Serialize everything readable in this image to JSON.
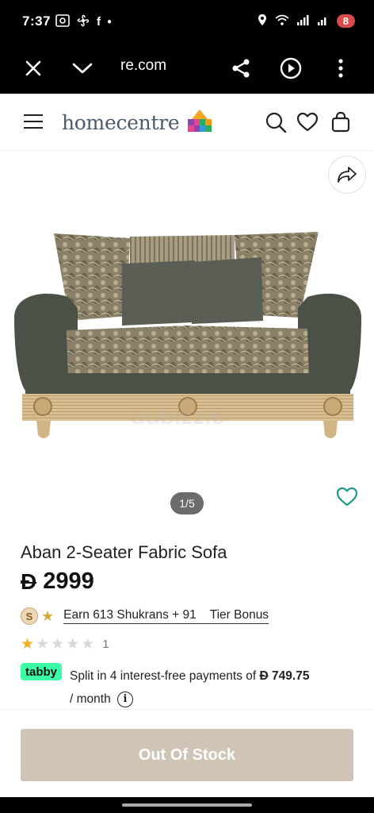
{
  "status_bar": {
    "time": "7:37",
    "battery": "8"
  },
  "browser": {
    "url": "re.com"
  },
  "site": {
    "logo_text": "homecentre"
  },
  "gallery": {
    "pager": "1/5",
    "watermark": "dubizzle"
  },
  "product": {
    "title": "Aban 2-Seater Fabric Sofa",
    "currency_symbol": "Đ",
    "price": "2999",
    "shukran_text": "Earn 613 Shukrans + 91    Tier Bonus",
    "rating_stars": 1,
    "rating_max": 5,
    "rating_count": "1",
    "tabby_label": "tabby",
    "tabby_text_before": "Split in 4 interest-free payments of",
    "tabby_currency": "Đ",
    "tabby_amount": "749.75",
    "tabby_text_after": "/ month"
  },
  "actions": {
    "out_of_stock_label": "Out Of Stock"
  },
  "colors": {
    "tabby_green": "#3bffa6",
    "oos_button": "#cfc4b6",
    "wishlist_teal": "#1f9a8a",
    "rating_star": "#f2b01e"
  }
}
